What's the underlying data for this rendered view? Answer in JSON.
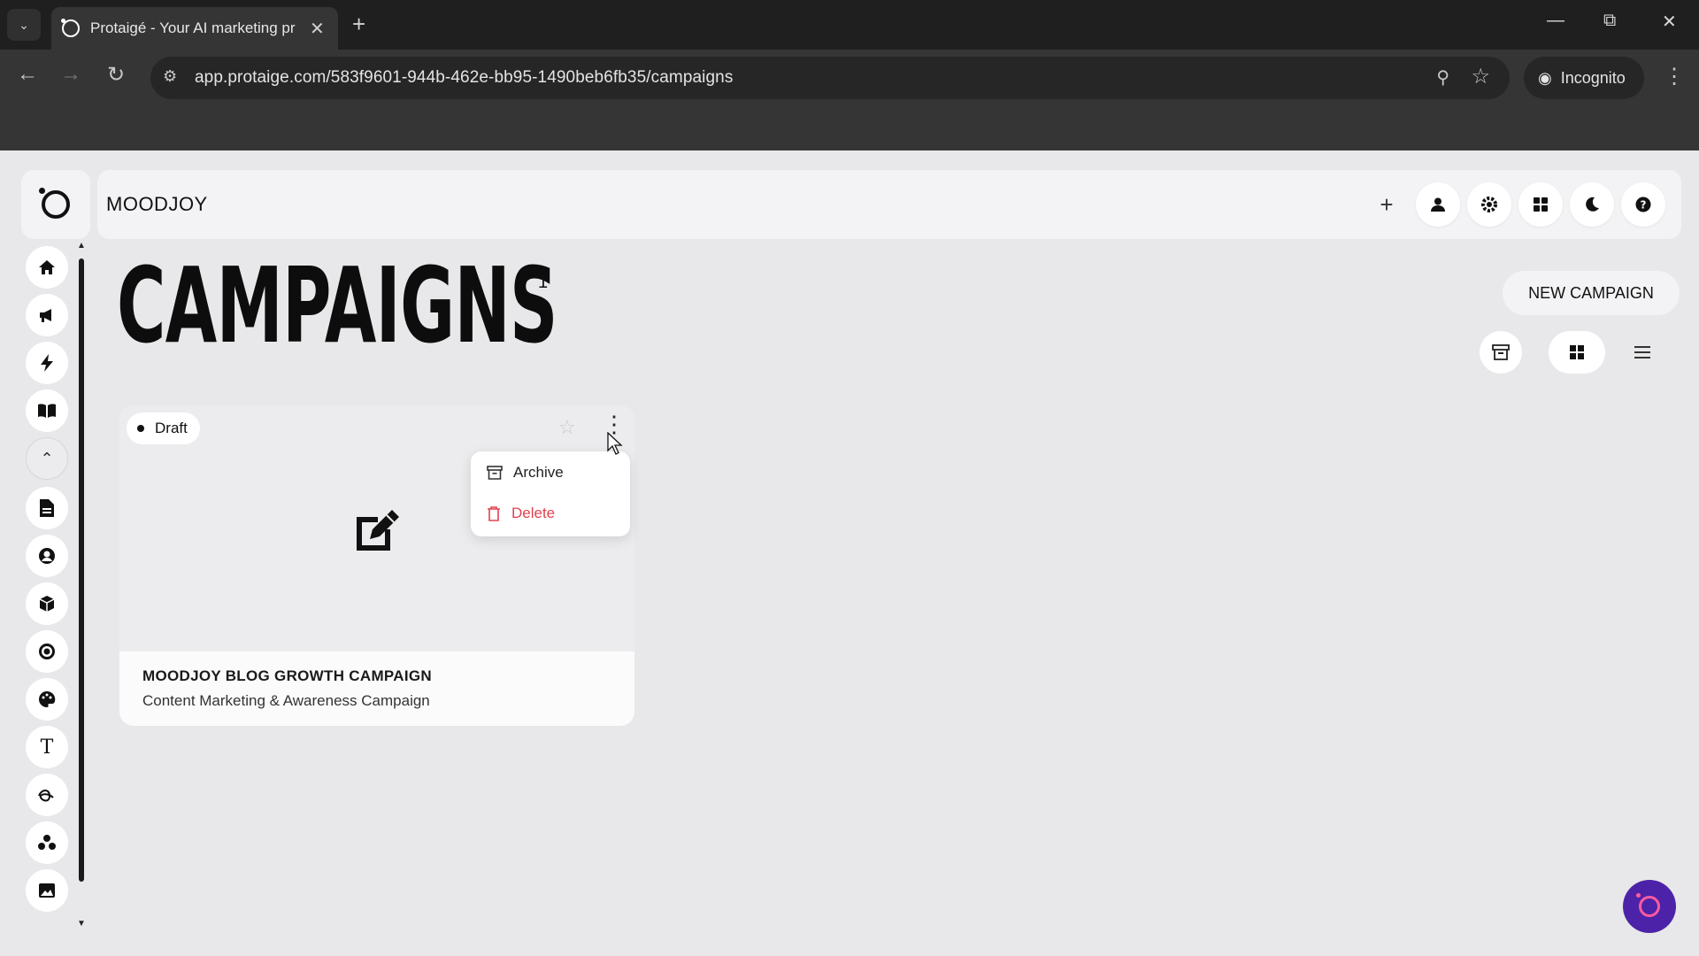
{
  "browser": {
    "tab_title": "Protaigé - Your AI marketing pr",
    "url": "app.protaige.com/583f9601-944b-462e-bb95-1490beb6fb35/campaigns",
    "incognito_label": "Incognito"
  },
  "app": {
    "workspace_name": "MOODJOY",
    "page_title": "CAMPAIGNS",
    "campaign_count": "1",
    "new_campaign_label": "NEW CAMPAIGN"
  },
  "campaign_card": {
    "status": "Draft",
    "title": "MOODJOY BLOG GROWTH CAMPAIGN",
    "subtitle": "Content Marketing & Awareness Campaign"
  },
  "card_menu": {
    "archive_label": "Archive",
    "delete_label": "Delete"
  },
  "colors": {
    "delete": "#e0434e",
    "chat_fab": "#4c23a8",
    "chat_accent": "#ff5aa0"
  }
}
